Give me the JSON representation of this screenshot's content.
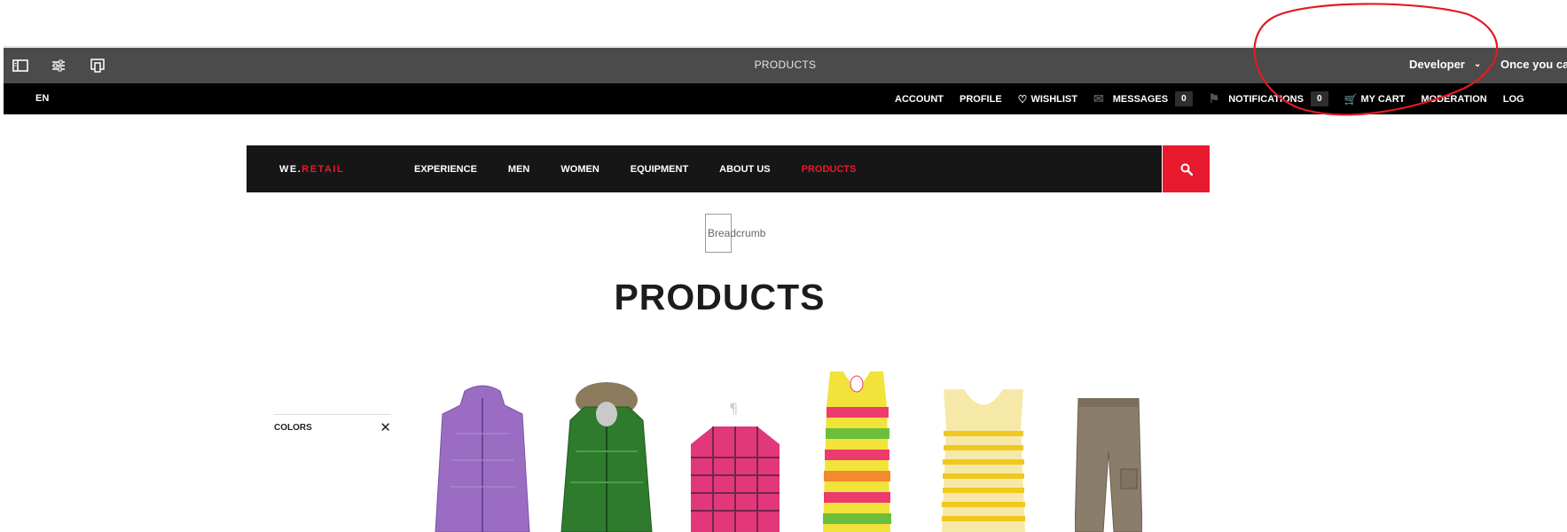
{
  "editor": {
    "title": "PRODUCTS",
    "mode": "Developer",
    "extra_text": "Once you ca",
    "icons": [
      "side-panel-icon",
      "page-properties-icon",
      "emulator-icon"
    ]
  },
  "utility": {
    "language": "EN",
    "account": "ACCOUNT",
    "profile": "PROFILE",
    "wishlist": "WISHLIST",
    "messages": "MESSAGES",
    "messages_count": "0",
    "notifications": "NOTIFICATIONS",
    "notifications_count": "0",
    "cart": "MY CART",
    "moderation": "MODERATION",
    "logout": "LOG"
  },
  "nav": {
    "logo_prefix": "WE.",
    "logo_brand": "RETAIL",
    "links": [
      "EXPERIENCE",
      "MEN",
      "WOMEN",
      "EQUIPMENT",
      "ABOUT US",
      "PRODUCTS"
    ],
    "active": "PRODUCTS"
  },
  "breadcrumb": "Breadcrumb",
  "page_title": "PRODUCTS",
  "filter": {
    "label": "COLORS"
  },
  "products": [
    "purple ski jacket",
    "green fur-hood jacket",
    "pink plaid shirt",
    "striped tank top",
    "yellow striped tank top",
    "grey cargo shorts"
  ],
  "annotation_color": "#e31b23",
  "accent_color": "#e8192c"
}
